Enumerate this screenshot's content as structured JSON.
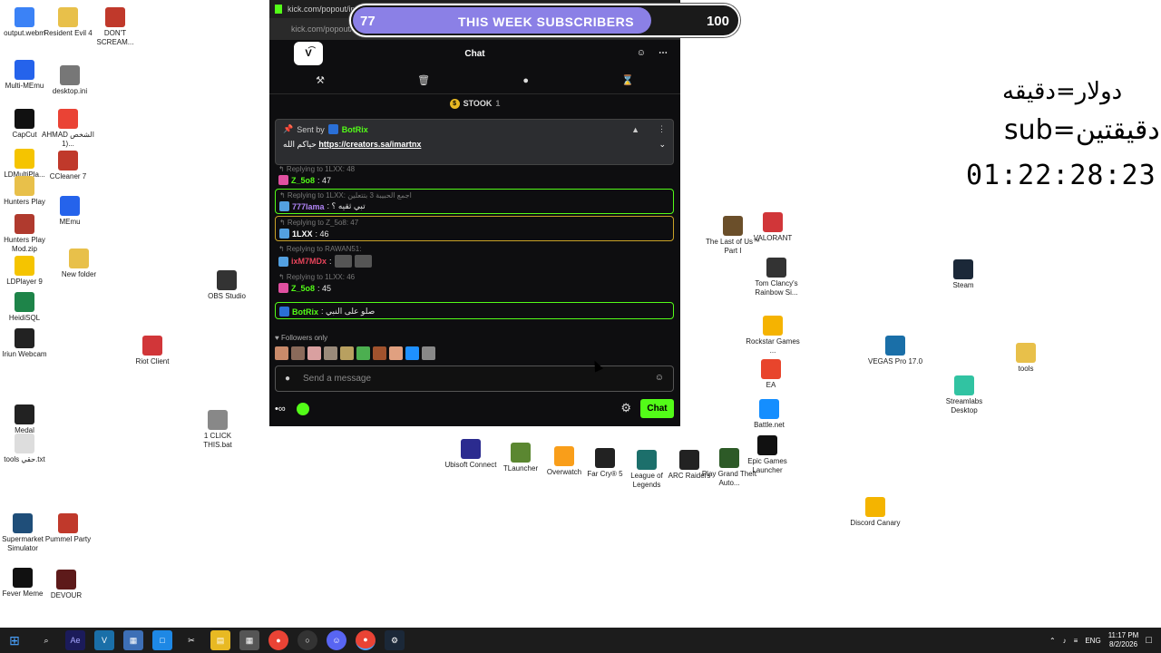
{
  "desktop_icons": [
    {
      "label": "output.webm",
      "icon": "video-file-icon",
      "color": "#3b82f6"
    },
    {
      "label": "Resident Evil 4",
      "icon": "folder-icon",
      "color": "#e8c04a"
    },
    {
      "label": "DON'T SCREAM...",
      "icon": "game-icon",
      "color": "#c0392b"
    },
    {
      "label": "Multi-MEmu",
      "icon": "memu-icon",
      "color": "#2563eb"
    },
    {
      "label": "desktop.ini",
      "icon": "settings-file-icon",
      "color": "#777777"
    },
    {
      "label": "CapCut",
      "icon": "capcut-icon",
      "color": "#111111"
    },
    {
      "label": "AHMAD الشخص (1...",
      "icon": "chrome-icon",
      "color": "#ea4335"
    },
    {
      "label": "LDMultiPla...",
      "icon": "ldplayer-icon",
      "color": "#f5c400"
    },
    {
      "label": "CCleaner 7",
      "icon": "ccleaner-icon",
      "color": "#c0392b"
    },
    {
      "label": "Hunters Play",
      "icon": "folder-icon",
      "color": "#e8c04a"
    },
    {
      "label": "MEmu",
      "icon": "memu-icon",
      "color": "#2563eb"
    },
    {
      "label": "Hunters Play Mod.zip",
      "icon": "zip-icon",
      "color": "#b03a2e"
    },
    {
      "label": "LDPlayer 9",
      "icon": "ldplayer-icon",
      "color": "#f5c400"
    },
    {
      "label": "New folder",
      "icon": "folder-icon",
      "color": "#e8c04a"
    },
    {
      "label": "OBS Studio",
      "icon": "obs-icon",
      "color": "#333333"
    },
    {
      "label": "HeidiSQL",
      "icon": "heidisql-icon",
      "color": "#1e8449"
    },
    {
      "label": "Iriun Webcam",
      "icon": "webcam-icon",
      "color": "#222222"
    },
    {
      "label": "Riot Client",
      "icon": "riot-icon",
      "color": "#d13639"
    },
    {
      "label": "Medal",
      "icon": "medal-icon",
      "color": "#222222"
    },
    {
      "label": "1 CLICK THIS.bat",
      "icon": "batch-file-icon",
      "color": "#888888"
    },
    {
      "label": "tools حقي.txt",
      "icon": "text-file-icon",
      "color": "#dddddd"
    },
    {
      "label": "Supermarket Simulator",
      "icon": "game-icon",
      "color": "#1f4e79"
    },
    {
      "label": "Pummel Party",
      "icon": "game-icon",
      "color": "#c0392b"
    },
    {
      "label": "Fever Meme",
      "icon": "game-icon",
      "color": "#111111"
    },
    {
      "label": "DEVOUR",
      "icon": "game-icon",
      "color": "#5d1a1a"
    },
    {
      "label": "The Last of Us™ Part I",
      "icon": "game-icon",
      "color": "#6b4f2a"
    },
    {
      "label": "VALORANT",
      "icon": "valorant-icon",
      "color": "#d13639"
    },
    {
      "label": "Tom Clancy's Rainbow Si...",
      "icon": "game-icon",
      "color": "#333333"
    },
    {
      "label": "Steam",
      "icon": "steam-icon",
      "color": "#1b2838"
    },
    {
      "label": "Rockstar Games ...",
      "icon": "rockstar-icon",
      "color": "#f5b301"
    },
    {
      "label": "EA",
      "icon": "ea-icon",
      "color": "#e8452c"
    },
    {
      "label": "Battle.net",
      "icon": "battlenet-icon",
      "color": "#148eff"
    },
    {
      "label": "VEGAS Pro 17.0",
      "icon": "vegas-icon",
      "color": "#1a6fa8"
    },
    {
      "label": "tools",
      "icon": "folder-icon",
      "color": "#e8c04a"
    },
    {
      "label": "Streamlabs Desktop",
      "icon": "streamlabs-icon",
      "color": "#31c3a2"
    },
    {
      "label": "Discord Canary",
      "icon": "discord-icon",
      "color": "#f4b400"
    },
    {
      "label": "Ubisoft Connect",
      "icon": "ubisoft-icon",
      "color": "#2b2b8f"
    },
    {
      "label": "TLauncher",
      "icon": "minecraft-icon",
      "color": "#5b8731"
    },
    {
      "label": "Overwatch",
      "icon": "overwatch-icon",
      "color": "#f99e1a"
    },
    {
      "label": "Far Cry® 5",
      "icon": "game-icon",
      "color": "#222222"
    },
    {
      "label": "League of Legends",
      "icon": "lol-icon",
      "color": "#1c6f6b"
    },
    {
      "label": "ARC Raiders",
      "icon": "game-icon",
      "color": "#222222"
    },
    {
      "label": "Play Grand Theft Auto...",
      "icon": "gta-icon",
      "color": "#2d5a27"
    },
    {
      "label": "Epic Games Launcher",
      "icon": "epic-icon",
      "color": "#111111"
    }
  ],
  "browser": {
    "tab_title": "kick.com/popout/im...",
    "url": "kick.com/popout/..."
  },
  "chat": {
    "header_title": "Chat",
    "logo_text": "V͡",
    "pinned_sent_by": "Sent by",
    "pinned_user": "BotRix",
    "pinned_prefix": "حياكم الله",
    "pinned_link": "https://creators.sa/imartnx",
    "stook_label": "STOOK",
    "stook_count": "1",
    "messages": [
      {
        "reply": "Replying to 1LXX: 48",
        "user": "Z_5o8",
        "user_color": "#53fc18",
        "text": ": 47",
        "highlight": "none"
      },
      {
        "reply": "Replying to 1LXX: اجمع الحبيبة 3 بتتعلين",
        "user": "777lama",
        "user_color": "#b084f5",
        "text": ": تبي ثقيه ؟",
        "highlight": "green"
      },
      {
        "reply": "Replying to Z_5o8: 47",
        "user": "1LXX",
        "user_color": "#ffffff",
        "text": ": 46",
        "highlight": "yellow"
      },
      {
        "reply": "Replying to RAWAN51:",
        "user": "ixM7MDx",
        "user_color": "#e8445a",
        "text": ":",
        "highlight": "none"
      },
      {
        "reply": "Replying to 1LXX: 46",
        "user": "Z_5o8",
        "user_color": "#53fc18",
        "text": ": 45",
        "highlight": "none"
      },
      {
        "reply": "",
        "user": "BotRix",
        "user_color": "#53fc18",
        "text": ": صلو على النبي",
        "highlight": "green"
      }
    ],
    "followers_only": "Followers only",
    "message_placeholder": "Send a message",
    "chat_button": "Chat"
  },
  "subscribers_bar": {
    "current": "77",
    "label": "THIS WEEK SUBSCRIBERS",
    "goal": "100",
    "progress": 0.77,
    "fill_color": "#8b80e6"
  },
  "overlay": {
    "line1": "دولار=دقيقه",
    "line2": "sub=دقيقتين",
    "timer": "01:22:28:23"
  },
  "taskbar": {
    "lang": "ENG",
    "time": "11:17 PM",
    "date": "8/2/2026"
  }
}
